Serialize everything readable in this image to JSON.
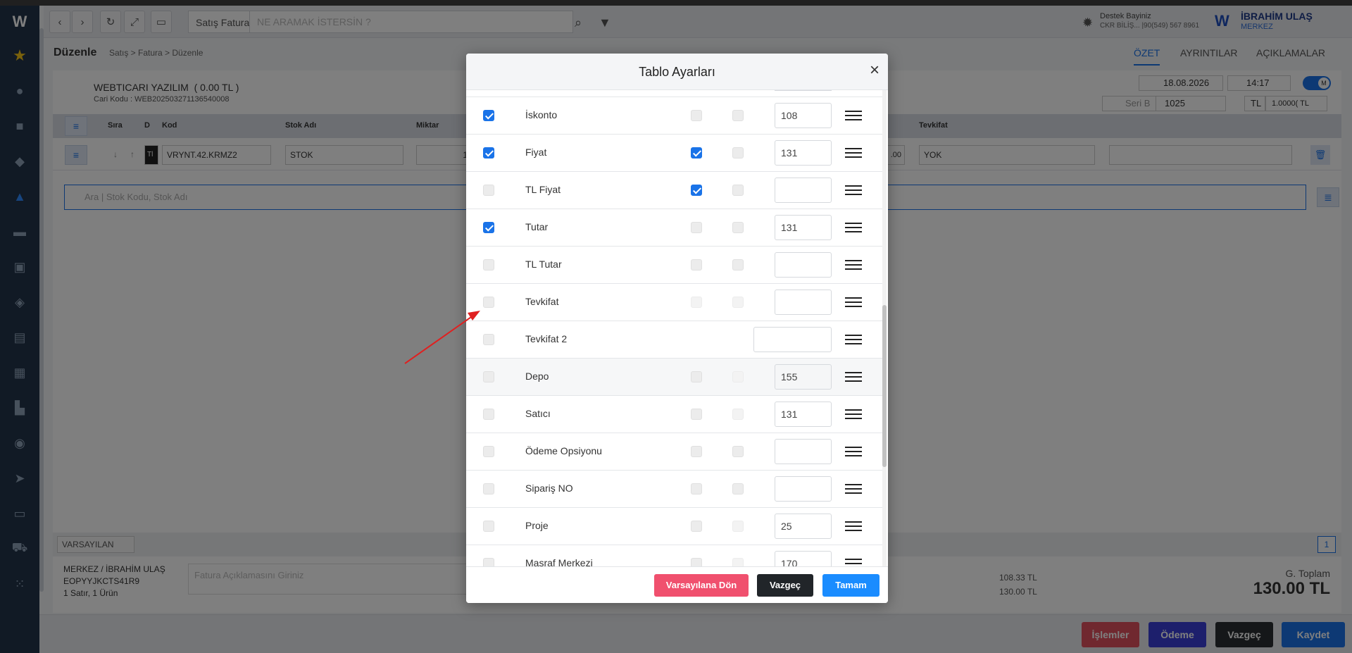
{
  "topbar": {
    "title": "Satış Fatura",
    "search_placeholder": "NE ARAMAK İSTERSİN ?",
    "support_title": "Destek Bayiniz",
    "support_info": "CKR BİLİŞ... |90(549) 567 8961",
    "user_name": "İBRAHİM ULAŞ",
    "user_branch": "MERKEZ"
  },
  "subbar": {
    "page_title": "Düzenle",
    "breadcrumb": "Satış > Fatura > Düzenle",
    "tabs": [
      "ÖZET",
      "AYRINTILAR",
      "AÇIKLAMALAR"
    ]
  },
  "invoice": {
    "company": "WEBTICARI YAZILIM",
    "balance": "( 0.00 TL )",
    "cari_code": "Cari Kodu : WEB202503271136540008",
    "date": "18.08.2026",
    "time": "14:17",
    "serial_label": "Seri B",
    "serial_no": "1025",
    "currency": "TL",
    "rate": "1.0000( TL"
  },
  "table": {
    "headers": [
      "Sıra",
      "D",
      "Kod",
      "Stok Adı",
      "Miktar",
      "Tevkifat"
    ],
    "row": {
      "kod": "VRYNT.42.KRMZ2",
      "stok": "STOK",
      "miktar": "1",
      "amount": ".00",
      "tevkifat": "YOK",
      "badge": "Tl"
    },
    "search_placeholder": "Ara | Stok Kodu, Stok Adı",
    "preset": "VARSAYILAN",
    "page": "1"
  },
  "footer": {
    "line1": "MERKEZ / İBRAHİM ULAŞ",
    "line2": "EOPYYJKCTS41R9",
    "line3": "1 Satır, 1 Ürün",
    "desc_placeholder": "Fatura Açıklamasını Giriniz",
    "amount1": "108.33 TL",
    "amount2": "130.00 TL",
    "total_label": "G. Toplam",
    "total_value": "130.00 TL"
  },
  "actions": [
    "İşlemler",
    "Ödeme",
    "Vazgeç",
    "Kaydet"
  ],
  "modal": {
    "title": "Tablo Ayarları",
    "close": "×",
    "rows": [
      {
        "label": "İskonto",
        "visible": true,
        "c2": false,
        "c3": false,
        "width": "108"
      },
      {
        "label": "Fiyat",
        "visible": true,
        "c2": true,
        "c3": false,
        "width": "131"
      },
      {
        "label": "TL Fiyat",
        "visible": false,
        "c2": true,
        "c3": false,
        "width": ""
      },
      {
        "label": "Tutar",
        "visible": true,
        "c2": false,
        "c3": false,
        "width": "131"
      },
      {
        "label": "TL Tutar",
        "visible": false,
        "c2": false,
        "c3": false,
        "width": ""
      },
      {
        "label": "Tevkifat",
        "visible": false,
        "c2": false,
        "c3": false,
        "width": ""
      },
      {
        "label": "Tevkifat 2",
        "visible": false,
        "c2": null,
        "c3": null,
        "width": ""
      },
      {
        "label": "Depo",
        "visible": false,
        "c2": false,
        "c3": false,
        "width": "155"
      },
      {
        "label": "Satıcı",
        "visible": false,
        "c2": false,
        "c3": false,
        "width": "131"
      },
      {
        "label": "Ödeme Opsiyonu",
        "visible": false,
        "c2": false,
        "c3": false,
        "width": ""
      },
      {
        "label": "Sipariş NO",
        "visible": false,
        "c2": false,
        "c3": false,
        "width": ""
      },
      {
        "label": "Proje",
        "visible": false,
        "c2": false,
        "c3": false,
        "width": "25"
      },
      {
        "label": "Masraf Merkezi",
        "visible": false,
        "c2": false,
        "c3": false,
        "width": "170"
      }
    ],
    "buttons": {
      "reset": "Varsayılana Dön",
      "cancel": "Vazgeç",
      "ok": "Tamam"
    }
  },
  "colors": {
    "accent": "#1a73e8",
    "reset_button": "#f0506e",
    "cancel_button": "#212529",
    "ok_button": "#1a8cff",
    "annotation_arrow": "#e02020"
  }
}
